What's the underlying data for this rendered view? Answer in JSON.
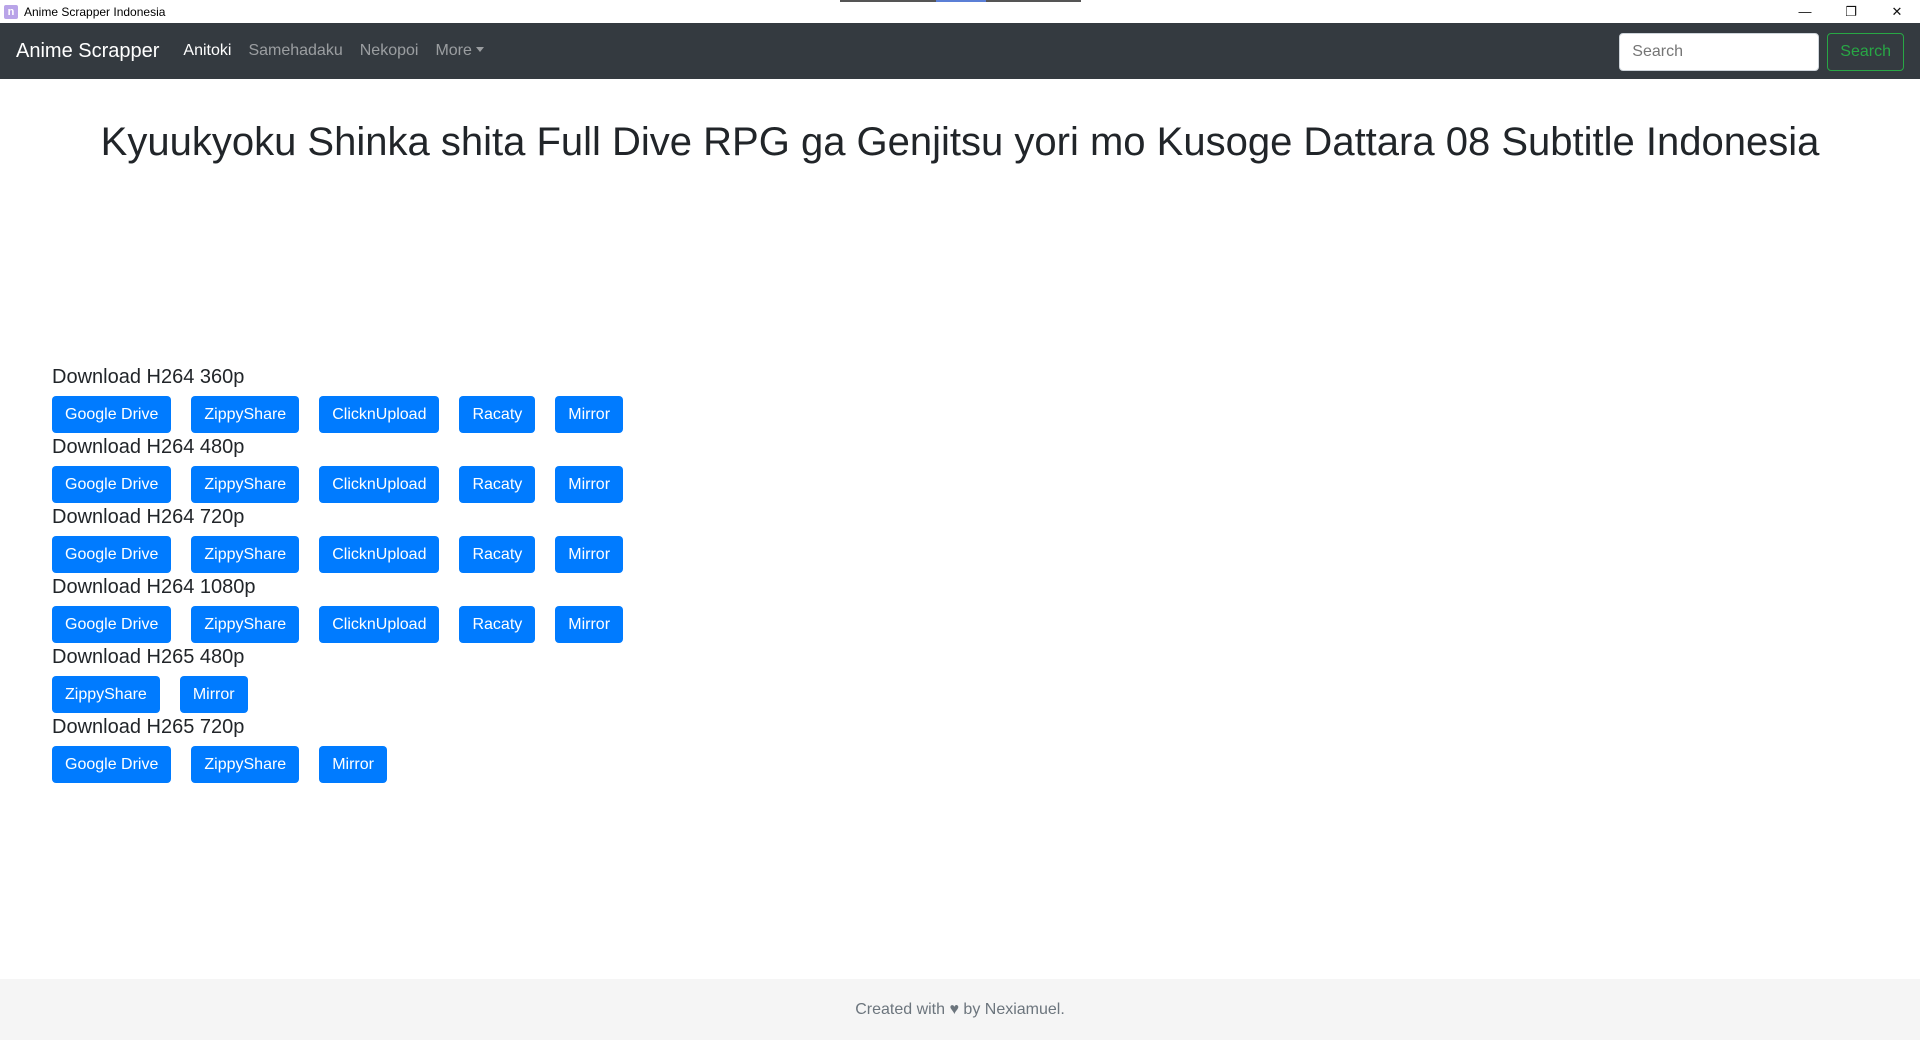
{
  "window": {
    "title": "Anime Scrapper Indonesia",
    "app_icon_letter": "n",
    "controls": {
      "minimize": "—",
      "maximize": "❐",
      "close": "✕"
    }
  },
  "navbar": {
    "brand": "Anime Scrapper",
    "links": [
      "Anitoki",
      "Samehadaku",
      "Nekopoi"
    ],
    "more_label": "More",
    "search_placeholder": "Search",
    "search_button": "Search"
  },
  "main": {
    "title": "Kyuukyoku Shinka shita Full Dive RPG ga Genjitsu yori mo Kusoge Dattara 08 Subtitle Indonesia",
    "sections": [
      {
        "title": "Download H264 360p",
        "buttons": [
          "Google Drive",
          "ZippyShare",
          "ClicknUpload",
          "Racaty",
          "Mirror"
        ]
      },
      {
        "title": "Download H264 480p",
        "buttons": [
          "Google Drive",
          "ZippyShare",
          "ClicknUpload",
          "Racaty",
          "Mirror"
        ]
      },
      {
        "title": "Download H264 720p",
        "buttons": [
          "Google Drive",
          "ZippyShare",
          "ClicknUpload",
          "Racaty",
          "Mirror"
        ]
      },
      {
        "title": "Download H264 1080p",
        "buttons": [
          "Google Drive",
          "ZippyShare",
          "ClicknUpload",
          "Racaty",
          "Mirror"
        ]
      },
      {
        "title": "Download H265 480p",
        "buttons": [
          "ZippyShare",
          "Mirror"
        ]
      },
      {
        "title": "Download H265 720p",
        "buttons": [
          "Google Drive",
          "ZippyShare",
          "Mirror"
        ]
      }
    ]
  },
  "footer": {
    "text": "Created with ♥ by Nexiamuel."
  },
  "colors": {
    "navbar_bg": "#343a40",
    "primary": "#007bff",
    "success": "#28a745",
    "footer_bg": "#f5f5f5"
  }
}
